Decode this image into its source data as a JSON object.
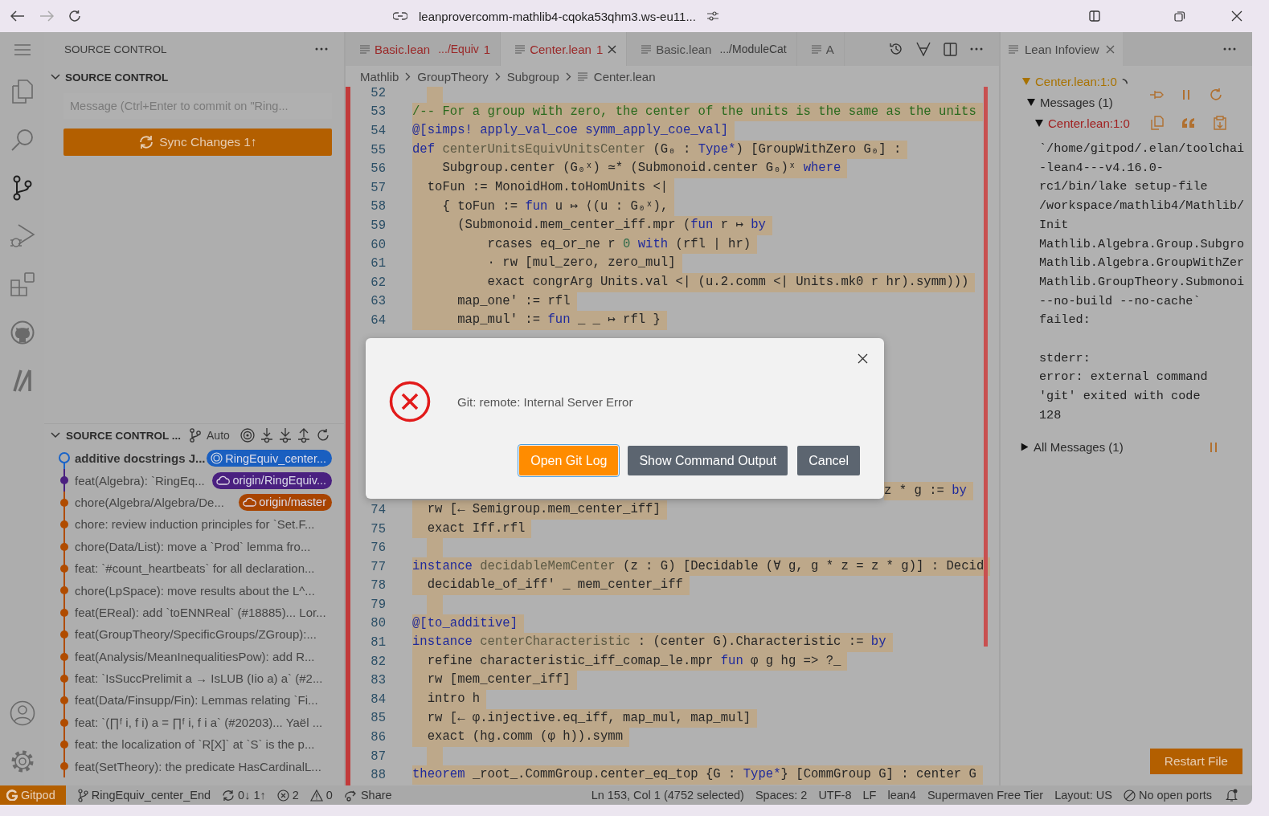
{
  "browser": {
    "url": "leanprovercomm-mathlib4-cqoka53qhm3.ws-eu11..."
  },
  "activity_bar": [
    {
      "kind": "menu",
      "selected": false
    },
    {
      "kind": "explorer",
      "selected": false
    },
    {
      "kind": "search",
      "selected": false
    },
    {
      "kind": "source-control",
      "selected": true
    },
    {
      "kind": "run-debug",
      "selected": false
    },
    {
      "kind": "extensions",
      "selected": false
    },
    {
      "kind": "github",
      "selected": false
    },
    {
      "kind": "lean",
      "selected": false
    }
  ],
  "activity_bottom": [
    {
      "kind": "account"
    },
    {
      "kind": "settings"
    }
  ],
  "sidebar": {
    "title": "SOURCE CONTROL"
  },
  "scm": {
    "section_title": "SOURCE CONTROL",
    "expanded": true,
    "message_placeholder": "Message (Ctrl+Enter to commit on \"Ring...",
    "sync_button": "Sync Changes 1↑"
  },
  "graph": {
    "section_title": "SOURCE CONTROL ...",
    "expanded": true,
    "auto_label": "Auto",
    "commits": [
      {
        "message": "additive docstrings  J...",
        "current": true,
        "color": "#1a64c8",
        "badge": {
          "label": "RingEquiv_center...",
          "kind": "local",
          "color": "#1a5fc0"
        }
      },
      {
        "message": "feat(Algebra): `RingEq...",
        "current": false,
        "color": "#4a2080",
        "badge": {
          "label": "origin/RingEquiv...",
          "kind": "remote",
          "color": "#4a2080"
        }
      },
      {
        "message": "chore(Algebra/Algebra/De...",
        "current": false,
        "color": "#b04c00",
        "badge": {
          "label": "origin/master",
          "kind": "remote",
          "color": "#a84400"
        }
      },
      {
        "message": "chore: review induction principles for `Set.F...",
        "current": false,
        "color": "#b04c00"
      },
      {
        "message": "chore(Data/List): move a `Prod` lemma fro...",
        "current": false,
        "color": "#b04c00"
      },
      {
        "message": "feat: `#count_heartbeats` for all declaration...",
        "current": false,
        "color": "#b04c00"
      },
      {
        "message": "chore(LpSpace): move results about the L^...",
        "current": false,
        "color": "#b04c00"
      },
      {
        "message": "feat(EReal): add `toENNReal` (#18885)...  Lor...",
        "current": false,
        "color": "#b04c00"
      },
      {
        "message": "feat(GroupTheory/SpecificGroups/ZGroup):...",
        "current": false,
        "color": "#b04c00"
      },
      {
        "message": "feat(Analysis/MeanInequalitiesPow): add R...",
        "current": false,
        "color": "#b04c00"
      },
      {
        "message": "feat: `IsSuccPrelimit a → IsLUB (Iio a) a` (#2...",
        "current": false,
        "color": "#b04c00"
      },
      {
        "message": "feat(Data/Finsupp/Fin): Lemmas relating `Fi...",
        "current": false,
        "color": "#b04c00"
      },
      {
        "message": "feat: `(∏ᶠ i, f i) a = ∏ᶠ i, f i a` (#20203)...  Yaël ...",
        "current": false,
        "color": "#b04c00"
      },
      {
        "message": "feat: the localization of `R[X]` at `S` is the p...",
        "current": false,
        "color": "#b04c00"
      },
      {
        "message": "feat(SetTheory): the predicate HasCardinalL...",
        "current": false,
        "color": "#b04c00"
      }
    ]
  },
  "tabs": [
    {
      "name": "Basic.lean",
      "description": ".../Equiv",
      "badge": "1",
      "error": true,
      "selected": false
    },
    {
      "name": "Center.lean",
      "badge": "1",
      "error": true,
      "selected": true
    },
    {
      "name": "Basic.lean",
      "description": ".../ModuleCat",
      "error": false,
      "selected": false
    },
    {
      "name": "A",
      "error": false,
      "selected": false
    }
  ],
  "breadcrumbs": [
    "Mathlib",
    "GroupTheory",
    "Subgroup",
    "Center.lean"
  ],
  "code": {
    "top": [
      {
        "n": "52"
      },
      {
        "n": "53",
        "segs": [
          {
            "kind": "comment",
            "text": "/-- For a group with zero, the center of the units is the same as the units"
          }
        ]
      },
      {
        "n": "54",
        "segs": [
          {
            "kind": "attribute",
            "text": "@[simps! apply_val_coe symm_apply_coe_val]"
          }
        ]
      },
      {
        "n": "55",
        "segs": [
          {
            "kind": "keyword",
            "text": "def "
          },
          {
            "kind": "name",
            "text": "centerUnitsEquivUnitsCenter "
          },
          {
            "kind": "plain",
            "text": "(G₀ : "
          },
          {
            "kind": "keyword",
            "text": "Type*"
          },
          {
            "kind": "plain",
            "text": ") [GroupWithZero G₀] :"
          }
        ]
      },
      {
        "n": "56",
        "segs": [
          {
            "kind": "plain",
            "text": "    Subgroup.center (G₀ˣ) ≃* (Submonoid.center G₀)ˣ "
          },
          {
            "kind": "keyword",
            "text": "where"
          }
        ]
      },
      {
        "n": "57",
        "segs": [
          {
            "kind": "plain",
            "text": "  toFun := MonoidHom.toHomUnits <|"
          }
        ]
      },
      {
        "n": "58",
        "segs": [
          {
            "kind": "plain",
            "text": "    { toFun := "
          },
          {
            "kind": "keyword",
            "text": "fun"
          },
          {
            "kind": "plain",
            "text": " u ↦ ⟨(u : G₀ˣ),"
          }
        ]
      },
      {
        "n": "59",
        "segs": [
          {
            "kind": "plain",
            "text": "      (Submonoid.mem_center_iff.mpr ("
          },
          {
            "kind": "keyword",
            "text": "fun"
          },
          {
            "kind": "plain",
            "text": " r ↦ "
          },
          {
            "kind": "keyword",
            "text": "by"
          }
        ]
      },
      {
        "n": "60",
        "segs": [
          {
            "kind": "plain",
            "text": "          rcases eq_or_ne r "
          },
          {
            "kind": "number",
            "text": "0"
          },
          {
            "kind": "keyword",
            "text": " with"
          },
          {
            "kind": "plain",
            "text": " (rfl | hr)"
          }
        ]
      },
      {
        "n": "61",
        "segs": [
          {
            "kind": "plain",
            "text": "          · rw [mul_zero, zero_mul]"
          }
        ]
      },
      {
        "n": "62",
        "segs": [
          {
            "kind": "plain",
            "text": "          exact congrArg Units.val <| (u.2.comm <| Units.mk0 r hr).symm)))"
          }
        ]
      },
      {
        "n": "63",
        "segs": [
          {
            "kind": "plain",
            "text": "      map_one' := rfl"
          }
        ]
      },
      {
        "n": "64",
        "segs": [
          {
            "kind": "plain",
            "text": "      map_mul' := "
          },
          {
            "kind": "keyword",
            "text": "fun"
          },
          {
            "kind": "plain",
            "text": " _ _ ↦ rfl }"
          }
        ]
      }
    ],
    "partial": {
      "segs": [
        {
          "kind": "plain",
          "text": "z * g := "
        },
        {
          "kind": "keyword",
          "text": "by"
        }
      ]
    },
    "bottom": [
      {
        "n": "74",
        "segs": [
          {
            "kind": "plain",
            "text": "  rw [← Semigroup.mem_center_iff]"
          }
        ]
      },
      {
        "n": "75",
        "segs": [
          {
            "kind": "plain",
            "text": "  exact Iff.rfl"
          }
        ]
      },
      {
        "n": "76"
      },
      {
        "n": "77",
        "segs": [
          {
            "kind": "keyword",
            "text": "instance "
          },
          {
            "kind": "name",
            "text": "decidableMemCenter "
          },
          {
            "kind": "plain",
            "text": "(z : G) [Decidable (∀ g, g * z = z * g)] : Decid"
          }
        ]
      },
      {
        "n": "78",
        "segs": [
          {
            "kind": "plain",
            "text": "  decidable_of_iff' _ mem_center_iff"
          }
        ]
      },
      {
        "n": "79"
      },
      {
        "n": "80",
        "segs": [
          {
            "kind": "attribute",
            "text": "@[to_additive]"
          }
        ]
      },
      {
        "n": "81",
        "segs": [
          {
            "kind": "keyword",
            "text": "instance "
          },
          {
            "kind": "name",
            "text": "centerCharacteristic "
          },
          {
            "kind": "plain",
            "text": ": (center G).Characteristic := "
          },
          {
            "kind": "keyword",
            "text": "by"
          }
        ]
      },
      {
        "n": "82",
        "segs": [
          {
            "kind": "plain",
            "text": "  refine characteristic_iff_comap_le.mpr "
          },
          {
            "kind": "keyword",
            "text": "fun"
          },
          {
            "kind": "plain",
            "text": " φ g hg => ?_"
          }
        ]
      },
      {
        "n": "83",
        "segs": [
          {
            "kind": "plain",
            "text": "  rw [mem_center_iff]"
          }
        ]
      },
      {
        "n": "84",
        "segs": [
          {
            "kind": "plain",
            "text": "  intro h"
          }
        ]
      },
      {
        "n": "85",
        "segs": [
          {
            "kind": "plain",
            "text": "  rw [← φ.injective.eq_iff, map_mul, map_mul]"
          }
        ]
      },
      {
        "n": "86",
        "segs": [
          {
            "kind": "plain",
            "text": "  exact (hg.comm (φ h)).symm"
          }
        ]
      },
      {
        "n": "87"
      },
      {
        "n": "88",
        "segs": [
          {
            "kind": "keyword",
            "text": "theorem "
          },
          {
            "kind": "plain",
            "text": "_root_.CommGroup.center_eq_top {G : "
          },
          {
            "kind": "keyword",
            "text": "Type*"
          },
          {
            "kind": "plain",
            "text": "} [CommGroup G] : center G"
          }
        ]
      }
    ]
  },
  "infoview": {
    "tab": "Lean Infoview",
    "file": {
      "label": "Center.lean:1:0",
      "expanded": true,
      "loading": true
    },
    "messages": {
      "label": "Messages (1)",
      "expanded": true
    },
    "message": {
      "label": "Center.lean:1:0",
      "expanded": true,
      "kind": "error",
      "paragraphs": [
        [
          "`/home/gitpod/.elan/toolchai",
          "-lean4---v4.16.0-",
          "rc1/bin/lake setup-file",
          "/workspace/mathlib4/Mathlib/",
          "Init",
          "Mathlib.Algebra.Group.Subgro",
          "Mathlib.Algebra.GroupWithZer",
          "Mathlib.GroupTheory.Submonoi",
          "--no-build --no-cache`",
          "failed:"
        ],
        [
          "stderr:",
          "error: external command",
          "'git' exited with code",
          "128"
        ]
      ]
    },
    "all_messages": {
      "label": "All Messages (1)",
      "expanded": false
    },
    "restart_button": "Restart File"
  },
  "status_left": [
    {
      "kind": "remote",
      "text": "Gitpod"
    },
    {
      "kind": "branch",
      "text": "RingEquiv_center_End"
    },
    {
      "kind": "sync",
      "text": "0↓ 1↑"
    },
    {
      "kind": "errors",
      "text": "2"
    },
    {
      "kind": "warnings",
      "text": "0"
    },
    {
      "kind": "share",
      "text": "Share"
    }
  ],
  "status_right": [
    {
      "kind": "text",
      "text": "Ln 153, Col 1 (4752 selected)"
    },
    {
      "kind": "text",
      "text": "Spaces: 2"
    },
    {
      "kind": "text",
      "text": "UTF-8"
    },
    {
      "kind": "text",
      "text": "LF"
    },
    {
      "kind": "text",
      "text": "lean4"
    },
    {
      "kind": "text",
      "text": "Supermaven Free Tier"
    },
    {
      "kind": "text",
      "text": "Layout: US"
    },
    {
      "kind": "ports",
      "text": "No open ports"
    },
    {
      "kind": "bell"
    }
  ],
  "dialog": {
    "message": "Git: remote: Internal Server Error",
    "buttons": [
      {
        "label": "Open Git Log",
        "kind": "primary"
      },
      {
        "label": "Show Command Output",
        "kind": "secondary"
      },
      {
        "label": "Cancel",
        "kind": "secondary"
      }
    ]
  }
}
